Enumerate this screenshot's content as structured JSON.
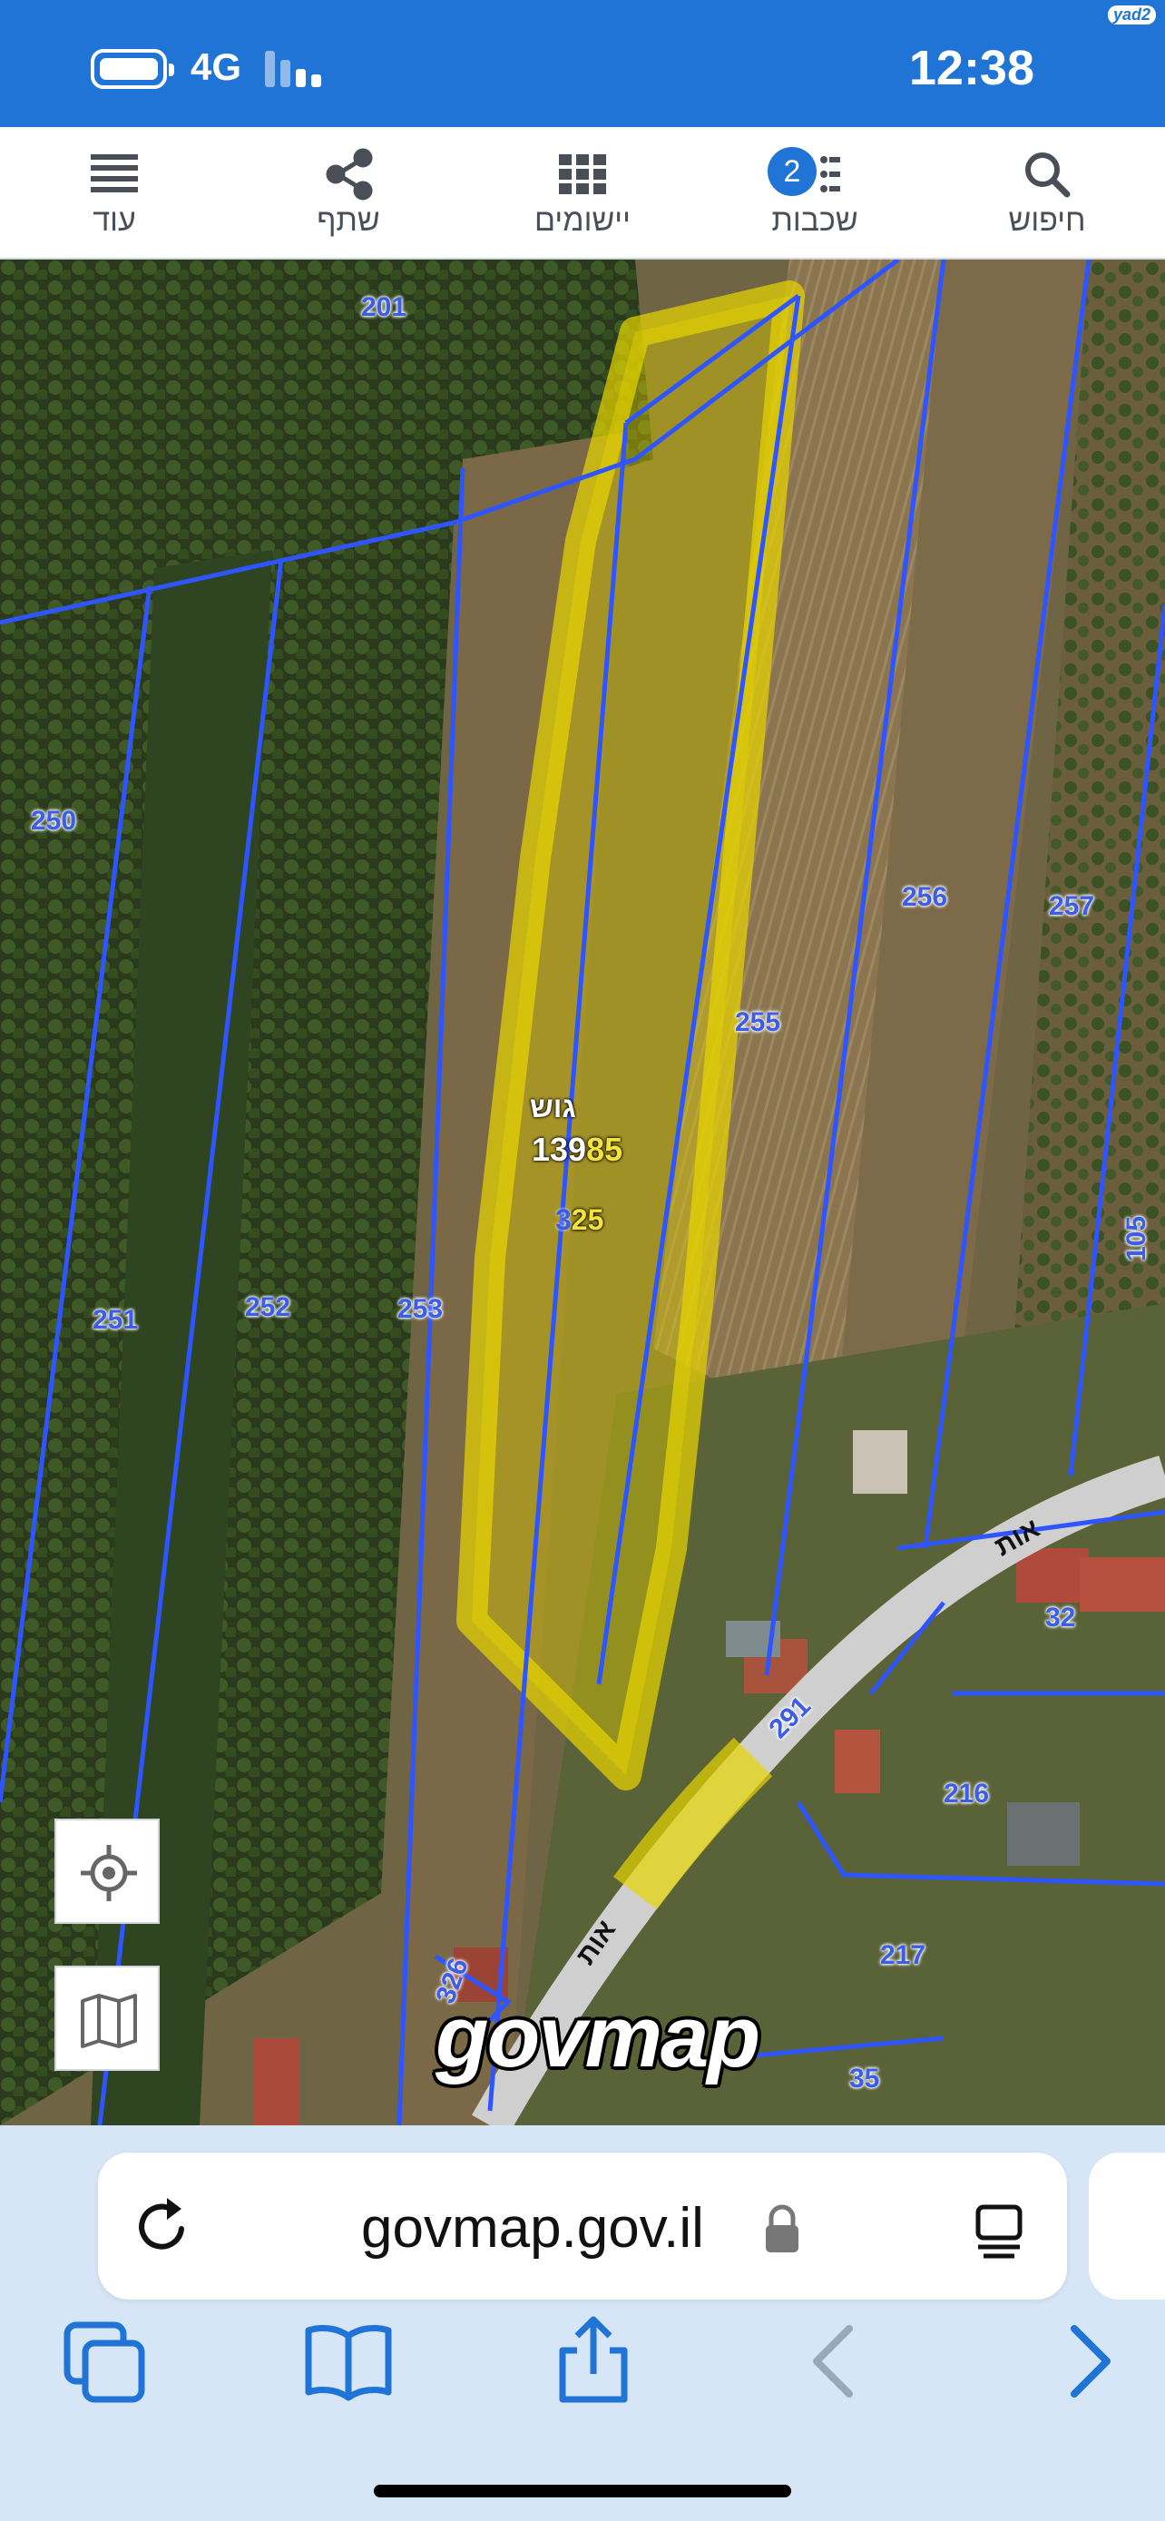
{
  "status_bar": {
    "network": "4G",
    "time": "12:38",
    "corner_tag": "yad2"
  },
  "toolbar": {
    "items": [
      {
        "label": "עוד",
        "icon": "menu-icon"
      },
      {
        "label": "שתף",
        "icon": "share-icon"
      },
      {
        "label": "יישומים",
        "icon": "apps-grid-icon"
      },
      {
        "label": "שכבות",
        "icon": "layers-icon",
        "badge": "2"
      },
      {
        "label": "חיפוש",
        "icon": "search-icon"
      }
    ]
  },
  "map": {
    "parcels": [
      "201",
      "250",
      "251",
      "252",
      "253",
      "255",
      "256",
      "257",
      "105",
      "32",
      "216",
      "217",
      "326",
      "35"
    ],
    "block": {
      "prefix": "גוש",
      "number_part1": "139",
      "number_part2": "85",
      "parcel_part1": "3",
      "parcel_part2": "25"
    },
    "roads": {
      "road_name_1": "אות",
      "road_number": "291",
      "road_name_2": "אות"
    },
    "logo": "govmap",
    "colors": {
      "parcel_line": "#2e55ff",
      "highlight": "#e6d200"
    }
  },
  "browser": {
    "url": "govmap.gov.il",
    "icons": [
      "reload-icon",
      "lock-icon",
      "reader-icon",
      "tabs-icon",
      "bookmarks-icon",
      "share-icon",
      "back-icon",
      "forward-icon"
    ]
  }
}
